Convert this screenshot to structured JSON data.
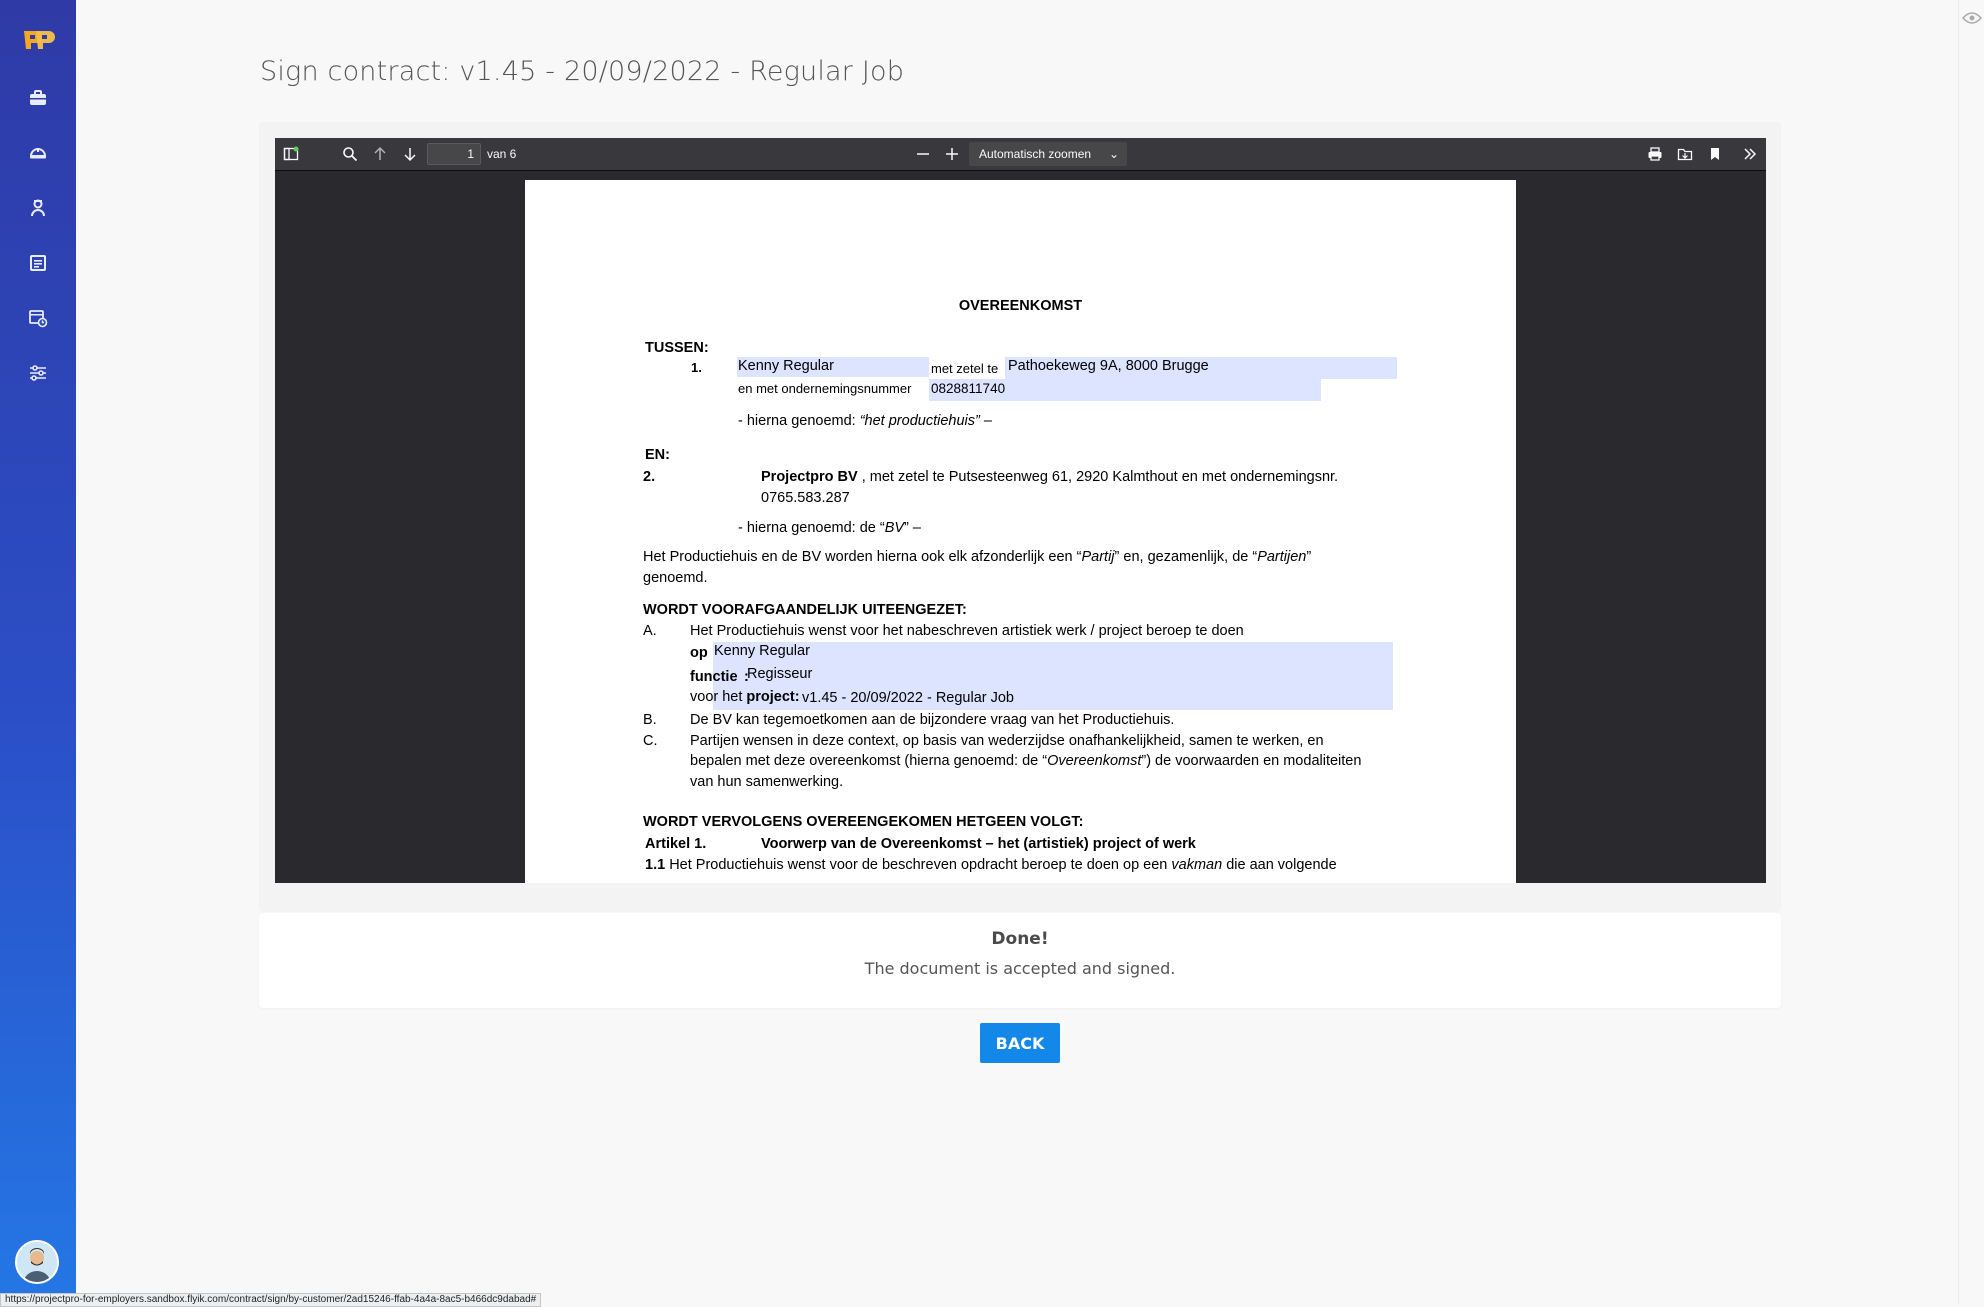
{
  "sidebar": {
    "items": [
      {
        "icon": "briefcase-icon"
      },
      {
        "icon": "helmet-icon"
      },
      {
        "icon": "worker-icon"
      },
      {
        "icon": "document-list-icon"
      },
      {
        "icon": "calendar-clock-icon"
      },
      {
        "icon": "sliders-icon"
      }
    ]
  },
  "page": {
    "title": "Sign contract: v1.45 - 20/09/2022 - Regular Job"
  },
  "viewer": {
    "page_number": "1",
    "page_count": "van 6",
    "zoom": "Automatisch zoomen"
  },
  "document": {
    "heading": "OVEREENKOMST",
    "tussen": "TUSSEN:",
    "party1_num": "1.",
    "party1_name": "Kenny Regular",
    "met_zetel_te": "met zetel te",
    "party1_address": "Pathoekeweg 9A, 8000 Brugge",
    "ondernemingsnummer_label": "en met ondernemingsnummer",
    "party1_vat": "0828811740",
    "hierna_productiehuis_prefix": "- hierna genoemd: ",
    "hierna_productiehuis_term": "“het productiehuis”",
    "hierna_productiehuis_suffix": " –",
    "en": "EN:",
    "party2_num": "2.",
    "party2_name": "Projectpro BV",
    "party2_rest": " , met zetel te Putsesteenweg 61, 2920 Kalmthout en met ondernemingsnr.",
    "party2_vat": "0765.583.287",
    "hierna_bv_prefix": "- hierna genoemd: de “",
    "hierna_bv_term": "BV",
    "hierna_bv_suffix": "” –",
    "parties_line1_a": "Het Productiehuis en de BV worden hierna ook elk afzonderlijk een “",
    "parties_line1_b": "Partij",
    "parties_line1_c": "” en, gezamenlijk, de “",
    "parties_line1_d": "Partijen",
    "parties_line1_e": "”",
    "parties_line2": "genoemd.",
    "section1_title": "WORDT VOORAFGAANDELIJK UITEENGEZET:",
    "a_label": "A.",
    "a_text": "Het Productiehuis wenst voor het nabeschreven artistiek werk / project beroep te doen",
    "op_label": "op",
    "op_value": "Kenny Regular",
    "functie_label": "functie",
    "functie_value": "Regisseur",
    "project_label_prefix": "voor het ",
    "project_label": "project:",
    "project_value": "v1.45 - 20/09/2022 - Regular Job",
    "b_label": "B.",
    "b_text": "De BV kan tegemoetkomen aan de bijzondere vraag van het Productiehuis.",
    "c_label": "C.",
    "c_line1": "Partijen wensen in deze context, op basis van wederzijdse onafhankelijkheid, samen te werken, en",
    "c_line2_a": "bepalen met deze overeenkomst (hierna genoemd: de “",
    "c_line2_b": "Overeenkomst",
    "c_line2_c": "”) de voorwaarden en modaliteiten",
    "c_line3": "van hun samenwerking.",
    "section2_title": "WORDT VERVOLGENS OVEREENGEKOMEN HETGEEN VOLGT:",
    "art1_label": "Artikel 1.",
    "art1_title": "Voorwerp van de Overeenkomst – het (artistiek) project of werk",
    "art11_num": "1.1",
    "art11_a": " Het Productiehuis wenst voor de beschreven opdracht beroep te doen op een ",
    "art11_b": "vakman",
    "art11_c": " die aan volgende"
  },
  "status": {
    "title": "Done!",
    "message": "The document is accepted and signed."
  },
  "actions": {
    "back_label": "BACK"
  },
  "statusbar": {
    "url": "https://projectpro-for-employers.sandbox.flyik.com/contract/sign/by-customer/2ad15246-ffab-4a4a-8ac5-b466dc9dabad#"
  }
}
